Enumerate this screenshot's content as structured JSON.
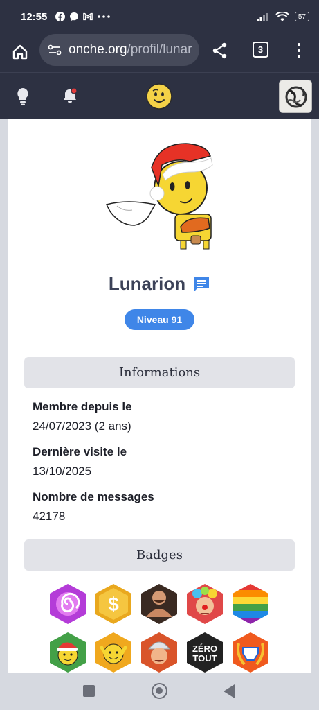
{
  "status_bar": {
    "time": "12:55",
    "battery": "57",
    "icons": [
      "facebook-icon",
      "messenger-icon",
      "gmail-icon",
      "more-icon",
      "signal-icon",
      "wifi-icon",
      "battery-icon"
    ]
  },
  "browser": {
    "url_host": "onche.org",
    "url_path": "/profil/lunar",
    "tab_count": "3"
  },
  "profile": {
    "username": "Lunarion",
    "level": "Niveau 91"
  },
  "informations": {
    "title": "Informations",
    "member_since_label": "Membre depuis le",
    "member_since_value": "24/07/2023 (2 ans)",
    "last_visit_label": "Dernière visite le",
    "last_visit_value": "13/10/2025",
    "messages_label": "Nombre de messages",
    "messages_value": "42178"
  },
  "badges": {
    "title": "Badges",
    "zero_tout_text_1": "ZÉRO",
    "zero_tout_text_2": "TOUT",
    "dollar_text": "$"
  },
  "colors": {
    "header_bg": "#2d3142",
    "accent_blue": "#3f86e8",
    "section_bg": "#e2e3e8",
    "page_bg": "#d6d9e0"
  }
}
